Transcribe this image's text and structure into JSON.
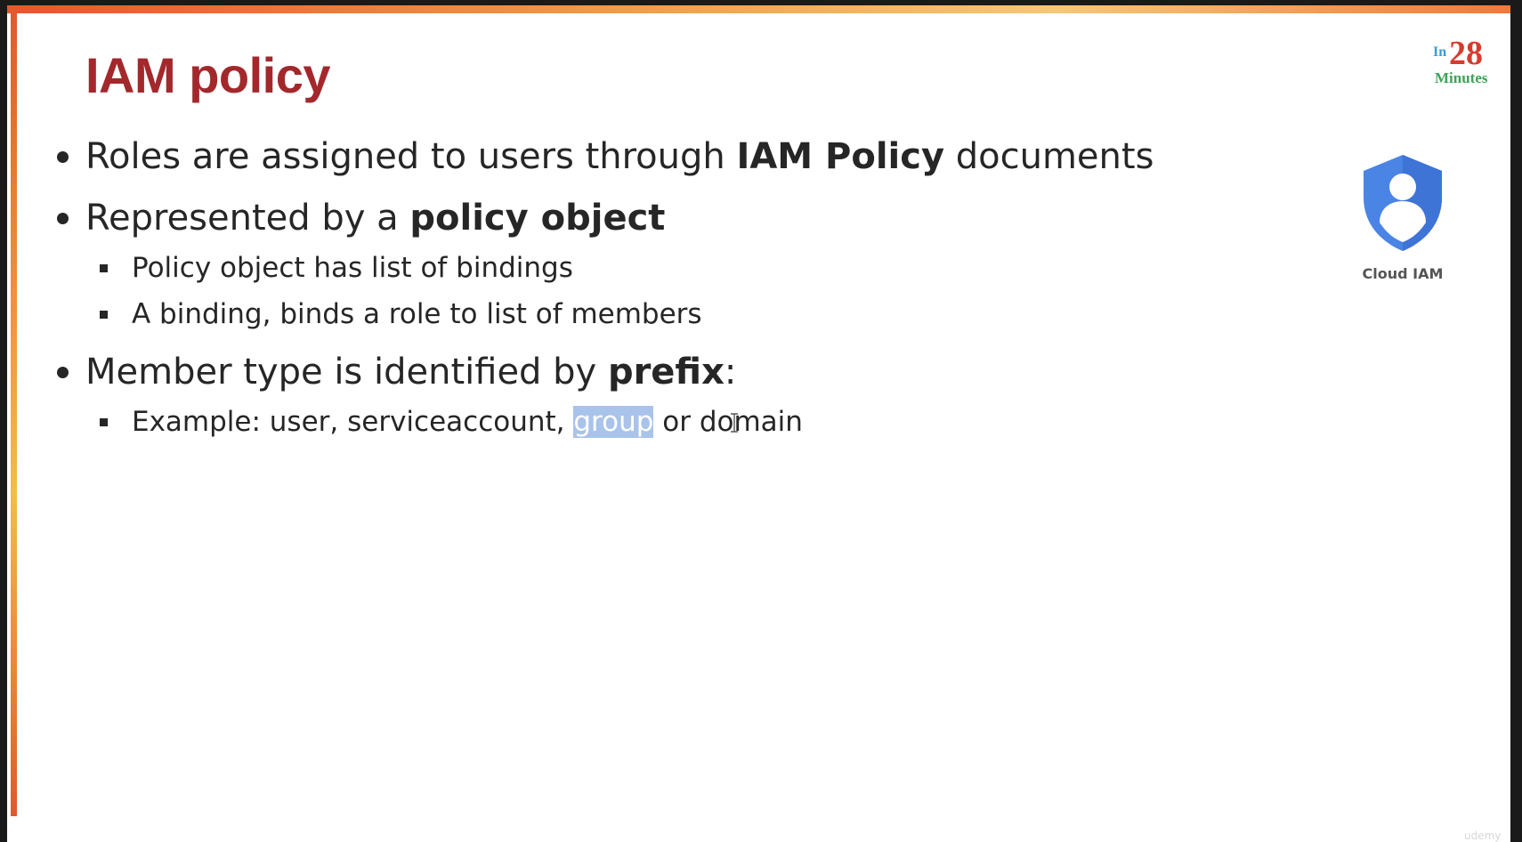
{
  "slide": {
    "title": "IAM policy",
    "brand": {
      "in": "In",
      "number": "28",
      "minutes": "Minutes"
    },
    "service_icon": {
      "icon": "cloud-iam-shield-icon",
      "label": "Cloud IAM",
      "color": "#4a84e4"
    },
    "bullets": [
      {
        "parts": [
          "Roles are assigned to users through ",
          "IAM Policy",
          " documents"
        ]
      },
      {
        "parts": [
          "Represented by a ",
          "policy object",
          ""
        ],
        "sub": [
          "Policy object has list of bindings",
          "A binding, binds a role to list of members"
        ]
      },
      {
        "parts": [
          "Member type is identified by ",
          "prefix",
          ":"
        ],
        "sub": [
          {
            "before": "Example: user, serviceaccount, ",
            "highlighted": "group",
            "after": " or domain"
          }
        ]
      }
    ],
    "watermark": "udemy"
  },
  "colors": {
    "title": "#a3282c",
    "highlight": "#a9c3ea",
    "accent_border": "#e4572e"
  }
}
